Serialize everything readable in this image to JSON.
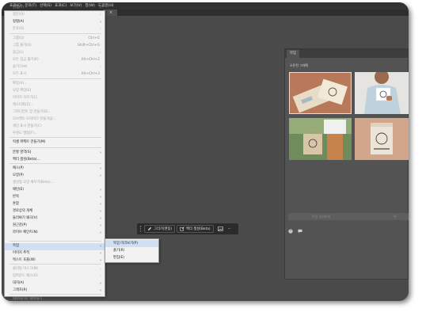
{
  "app": {
    "menubar": [
      "효과(C)",
      "문자(T)",
      "선택(S)",
      "효과(C)",
      "보기(V)",
      "창(W)",
      "도움말(H)"
    ],
    "tab_close": "×"
  },
  "context_menu": {
    "items": [
      {
        "label": "편집(T)",
        "disabled": true
      },
      {
        "label": "정돈(O)",
        "disabled": true
      },
      {
        "label": "정렬(A)",
        "disabled": false
      },
      {
        "label": "분포(G)",
        "disabled": true
      },
      {
        "label": "그룹(G)",
        "shortcut": "Ctrl+G",
        "disabled": true
      },
      {
        "label": "그룹 풀기(U)",
        "shortcut": "Shift+Ctrl+G",
        "disabled": true
      },
      {
        "label": "잠금(L)",
        "disabled": true
      },
      {
        "label": "모든 잠금 풀기(K)",
        "shortcut": "Alt+Ctrl+2",
        "disabled": true
      },
      {
        "label": "숨기기(H)",
        "disabled": true
      },
      {
        "label": "모두 표시",
        "shortcut": "Alt+Ctrl+3",
        "disabled": true
      },
      {
        "label": "확장(X)...",
        "disabled": true
      },
      {
        "label": "모양 확장(E)",
        "disabled": true
      },
      {
        "label": "이미지 자르기(C)",
        "disabled": true
      },
      {
        "label": "래스터화(Z)...",
        "disabled": true
      },
      {
        "label": "그라디언트 망 만들기(D)...",
        "disabled": true
      },
      {
        "label": "오브젝트 모자이크 만들기(J)...",
        "disabled": true
      },
      {
        "label": "재단 표시 만들기(C)",
        "disabled": true
      },
      {
        "label": "투명도 병합(F)...",
        "disabled": true
      },
      {
        "label": "픽셀 퍼펙트 만들기(M)",
        "disabled": false
      },
      {
        "label": "분할 영역(S)",
        "disabled": false
      },
      {
        "label": "벡터 생성(Beta)...",
        "disabled": false
      },
      {
        "label": "패스(P)",
        "disabled": false
      },
      {
        "label": "모양(P)",
        "disabled": false
      },
      {
        "label": "생성형 모양 채우기(Beta)...",
        "disabled": true
      },
      {
        "label": "패턴(E)",
        "disabled": false
      },
      {
        "label": "반복",
        "disabled": false
      },
      {
        "label": "혼합",
        "disabled": false
      },
      {
        "label": "경로상의 개체",
        "disabled": false
      },
      {
        "label": "둘러싸기 왜곡(V)",
        "disabled": false
      },
      {
        "label": "원근감(P)",
        "disabled": false
      },
      {
        "label": "라이브 페인트(N)",
        "disabled": false
      },
      {
        "label": "목업",
        "disabled": false
      },
      {
        "label": "이미지 추적",
        "disabled": false
      },
      {
        "label": "텍스트 포플(W)",
        "disabled": false
      },
      {
        "label": "클리핑 마스크(M)",
        "disabled": true
      },
      {
        "label": "컴파운드 패스(O)",
        "disabled": true
      },
      {
        "label": "대지(A)",
        "disabled": false
      },
      {
        "label": "그래프(R)",
        "disabled": false
      },
      {
        "label": "내보내기로 내보내기",
        "disabled": true
      }
    ]
  },
  "submenu": {
    "items": [
      "목업 미리보기(P)",
      "풀기(R)",
      "편집(E)"
    ]
  },
  "context_bar": {
    "generate_label": "그리기(텐팅)",
    "vector_label": "벡터 생성(Beta)",
    "more": "···"
  },
  "panel": {
    "tab_label": "목업",
    "subtitle": "오픈된 그래픽",
    "button_left": "목업 미리보기",
    "button_right": "편"
  },
  "colors": {
    "menu_highlight": "#cfe0f4",
    "workspace": "#4a4a4a",
    "panel": "#535353"
  }
}
